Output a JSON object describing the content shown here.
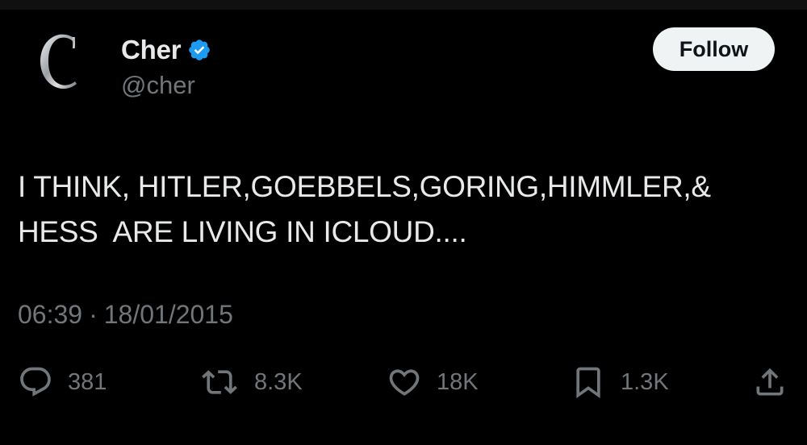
{
  "profile": {
    "display_name": "Cher",
    "handle": "@cher",
    "avatar_icon": "letter-c-logo",
    "verified_icon": "verified-badge-icon",
    "verified_color": "#1d9bf0"
  },
  "follow": {
    "label": "Follow"
  },
  "tweet": {
    "text": "I THINK, HITLER,GOEBBELS,GORING,HIMMLER,&\nHESS  ARE LIVING IN ICLOUD....",
    "time": "06:39",
    "separator": "·",
    "date": "18/01/2015"
  },
  "actions": {
    "replies": "381",
    "reposts": "8.3K",
    "likes": "18K",
    "bookmarks": "1.3K"
  },
  "colors": {
    "background": "#000000",
    "text_primary": "#e7e9ea",
    "text_secondary": "#71767b",
    "button_bg": "#eff3f4"
  }
}
